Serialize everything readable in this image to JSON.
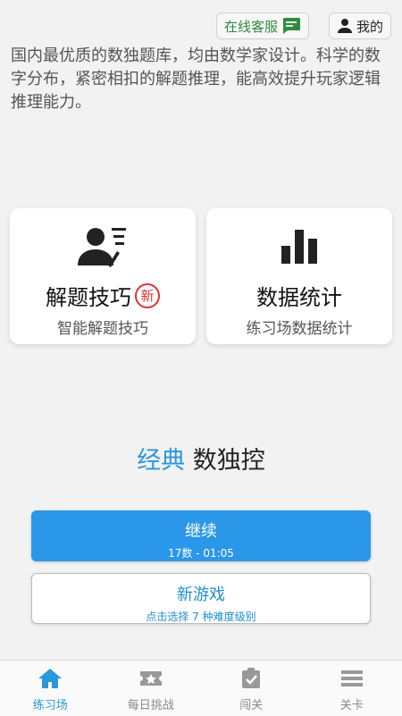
{
  "header": {
    "service_label": "在线客服",
    "mine_label": "我的",
    "service_color": "#2e8b3e"
  },
  "intro": {
    "text": "国内最优质的数独题库，均由数学家设计。科学的数字分布，紧密相扣的解题推理，能高效提升玩家逻辑推理能力。"
  },
  "cards": {
    "tips": {
      "title": "解题技巧",
      "badge": "新",
      "subtitle": "智能解题技巧",
      "icon": "person-list-icon"
    },
    "stats": {
      "title": "数据统计",
      "subtitle": "练习场数据统计",
      "icon": "bar-chart-icon"
    }
  },
  "game": {
    "title_part1": "经典",
    "title_part2": "数独控",
    "accent_color": "#2b97dc"
  },
  "continue_button": {
    "label": "继续",
    "detail": "17数 - 01:05"
  },
  "new_game_button": {
    "label": "新游戏",
    "detail": "点击选择 7 种难度级别"
  },
  "bottom_nav": [
    {
      "label": "练习场",
      "icon": "home-icon",
      "active": true
    },
    {
      "label": "每日挑战",
      "icon": "star-ticket-icon",
      "active": false
    },
    {
      "label": "闯关",
      "icon": "clipboard-check-icon",
      "active": false
    },
    {
      "label": "关卡",
      "icon": "list-icon",
      "active": false
    }
  ]
}
